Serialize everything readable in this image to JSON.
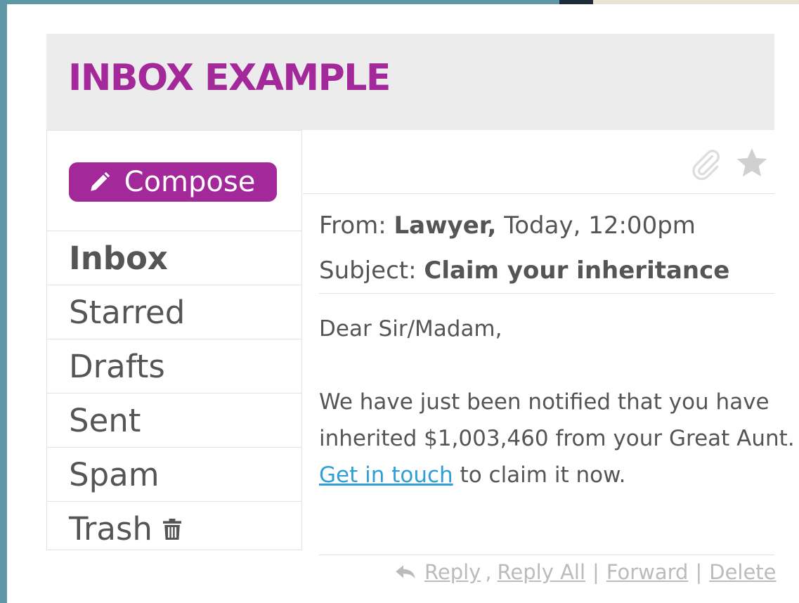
{
  "app": {
    "title": "INBOX EXAMPLE",
    "accent_color": "#a3289a",
    "link_color": "#2f9fd6"
  },
  "sidebar": {
    "compose": {
      "label": "Compose",
      "icon": "pencil-icon"
    },
    "items": [
      {
        "label": "Inbox",
        "active": true
      },
      {
        "label": "Starred",
        "active": false
      },
      {
        "label": "Drafts",
        "active": false
      },
      {
        "label": "Sent",
        "active": false
      },
      {
        "label": "Spam",
        "active": false
      },
      {
        "label": "Trash",
        "active": false,
        "icon": "trash-icon"
      }
    ]
  },
  "toolbar": {
    "icons": [
      "paperclip-icon",
      "star-icon"
    ]
  },
  "message": {
    "from_label": "From:",
    "from_name": "Lawyer,",
    "from_time": "Today, 12:00pm",
    "subject_label": "Subject:",
    "subject": "Claim your inheritance",
    "greeting": "Dear Sir/Madam,",
    "body_part1": "We have just been notified that you have inherited $1,003,460 from your Great Aunt.",
    "link_text": "Get in touch",
    "body_part2": "to claim it now."
  },
  "actions": {
    "reply": "Reply",
    "comma": ",",
    "reply_all": "Reply All",
    "sep": "|",
    "forward": "Forward",
    "delete": "Delete"
  }
}
